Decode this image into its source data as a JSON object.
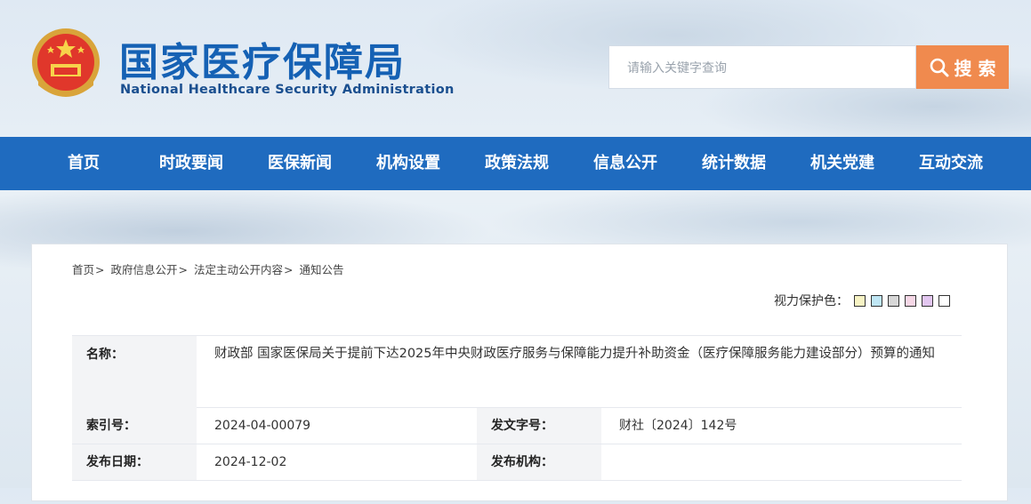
{
  "header": {
    "title": "国家医疗保障局",
    "subtitle": "National Healthcare Security Administration"
  },
  "search": {
    "placeholder": "请输入关键字查询",
    "button_label": "搜 索"
  },
  "nav": {
    "items": [
      "首页",
      "时政要闻",
      "医保新闻",
      "机构设置",
      "政策法规",
      "信息公开",
      "统计数据",
      "机关党建",
      "互动交流"
    ]
  },
  "breadcrumb": [
    "首页",
    "政府信息公开",
    "法定主动公开内容",
    "通知公告"
  ],
  "vision": {
    "label": "视力保护色：",
    "colors": [
      "#f7f3c4",
      "#bfe6f4",
      "#d7d7d7",
      "#f6d7e6",
      "#e2c6f0",
      "#ffffff"
    ]
  },
  "info": {
    "name_label": "名称：",
    "name_value": "财政部 国家医保局关于提前下达2025年中央财政医疗服务与保障能力提升补助资金（医疗保障服务能力建设部分）预算的通知",
    "index_label": "索引号：",
    "index_value": "2024-04-00079",
    "doc_label": "发文字号：",
    "doc_value": "财社〔2024〕142号",
    "date_label": "发布日期：",
    "date_value": "2024-12-02",
    "org_label": "发布机构：",
    "org_value": ""
  },
  "colors": {
    "nav_bg": "#1f6bbf",
    "title": "#1561b4",
    "search_button": "#f08a4e"
  }
}
